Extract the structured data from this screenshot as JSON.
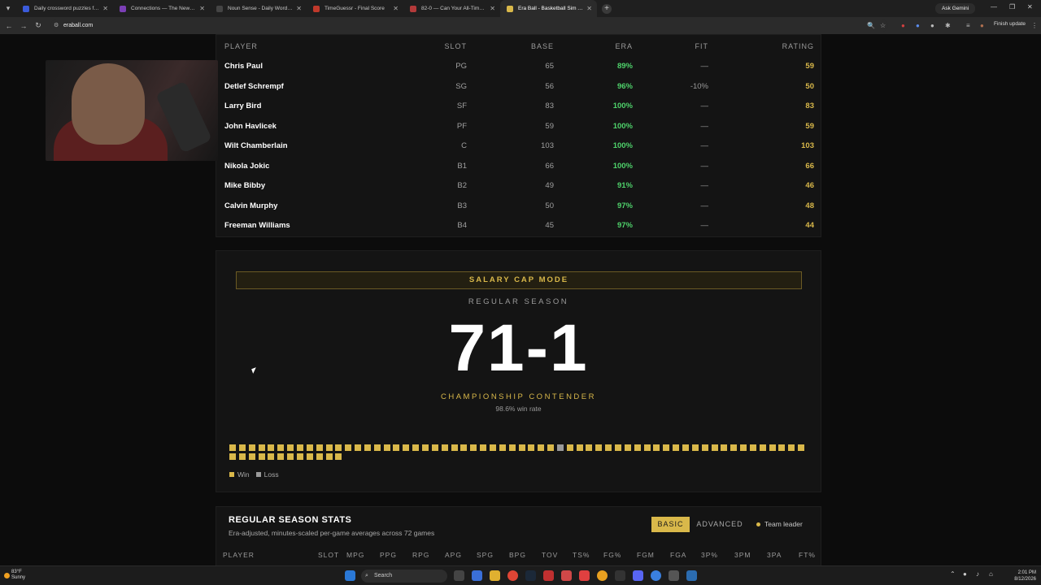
{
  "browser": {
    "tabs": [
      {
        "title": "Daily crossword puzzles free fr",
        "color": "#3b5bdb"
      },
      {
        "title": "Connections — The New York",
        "color": "#7b3fb5"
      },
      {
        "title": "Noun Sense - Daily Word Asso",
        "color": "#444444"
      },
      {
        "title": "TimeGuessr - Final Score",
        "color": "#c0392b"
      },
      {
        "title": "82-0 — Can Your All-Time NBA",
        "color": "#b33a3a"
      },
      {
        "title": "Era Ball - Basketball Sim Acros",
        "color": "#d9b84a",
        "active": true
      }
    ],
    "url": "eraball.com",
    "gemini_label": "Ask Gemini",
    "finish_update": "Finish update"
  },
  "roster": {
    "headers": {
      "player": "PLAYER",
      "slot": "SLOT",
      "base": "BASE",
      "era": "ERA",
      "fit": "FIT",
      "rating": "RATING"
    },
    "rows": [
      {
        "player": "Chris Paul",
        "slot": "PG",
        "base": "65",
        "era": "89%",
        "fit": "—",
        "rating": "59"
      },
      {
        "player": "Detlef Schrempf",
        "slot": "SG",
        "base": "56",
        "era": "96%",
        "fit": "-10%",
        "rating": "50"
      },
      {
        "player": "Larry Bird",
        "slot": "SF",
        "base": "83",
        "era": "100%",
        "fit": "—",
        "rating": "83"
      },
      {
        "player": "John Havlicek",
        "slot": "PF",
        "base": "59",
        "era": "100%",
        "fit": "—",
        "rating": "59"
      },
      {
        "player": "Wilt Chamberlain",
        "slot": "C",
        "base": "103",
        "era": "100%",
        "fit": "—",
        "rating": "103"
      },
      {
        "player": "Nikola Jokic",
        "slot": "B1",
        "base": "66",
        "era": "100%",
        "fit": "—",
        "rating": "66"
      },
      {
        "player": "Mike Bibby",
        "slot": "B2",
        "base": "49",
        "era": "91%",
        "fit": "—",
        "rating": "46"
      },
      {
        "player": "Calvin Murphy",
        "slot": "B3",
        "base": "50",
        "era": "97%",
        "fit": "—",
        "rating": "48"
      },
      {
        "player": "Freeman Williams",
        "slot": "B4",
        "base": "45",
        "era": "97%",
        "fit": "—",
        "rating": "44"
      }
    ]
  },
  "season": {
    "mode": "SALARY CAP MODE",
    "label": "REGULAR SEASON",
    "record": "71-1",
    "tier": "CHAMPIONSHIP CONTENDER",
    "win_rate": "98.6% win rate",
    "games_total": 72,
    "loss_game_index": 34,
    "legend": {
      "win": "Win",
      "loss": "Loss"
    },
    "colors": {
      "win": "#d9b84a",
      "loss": "#9a9a9a"
    }
  },
  "stats": {
    "title": "REGULAR SEASON STATS",
    "subtitle": "Era-adjusted, minutes-scaled per-game averages across 72 games",
    "basic_label": "BASIC",
    "advanced_label": "ADVANCED",
    "leader_label": "Team leader",
    "columns": [
      "PLAYER",
      "SLOT",
      "MPG",
      "PPG",
      "RPG",
      "APG",
      "SPG",
      "BPG",
      "TOV",
      "TS%",
      "FG%",
      "FGM",
      "FGA",
      "3P%",
      "3PM",
      "3PA",
      "FT%"
    ]
  },
  "taskbar": {
    "temp": "83°F",
    "weather": "Sunny",
    "search_placeholder": "Search",
    "time": "2:01 PM",
    "date": "8/12/2026"
  }
}
